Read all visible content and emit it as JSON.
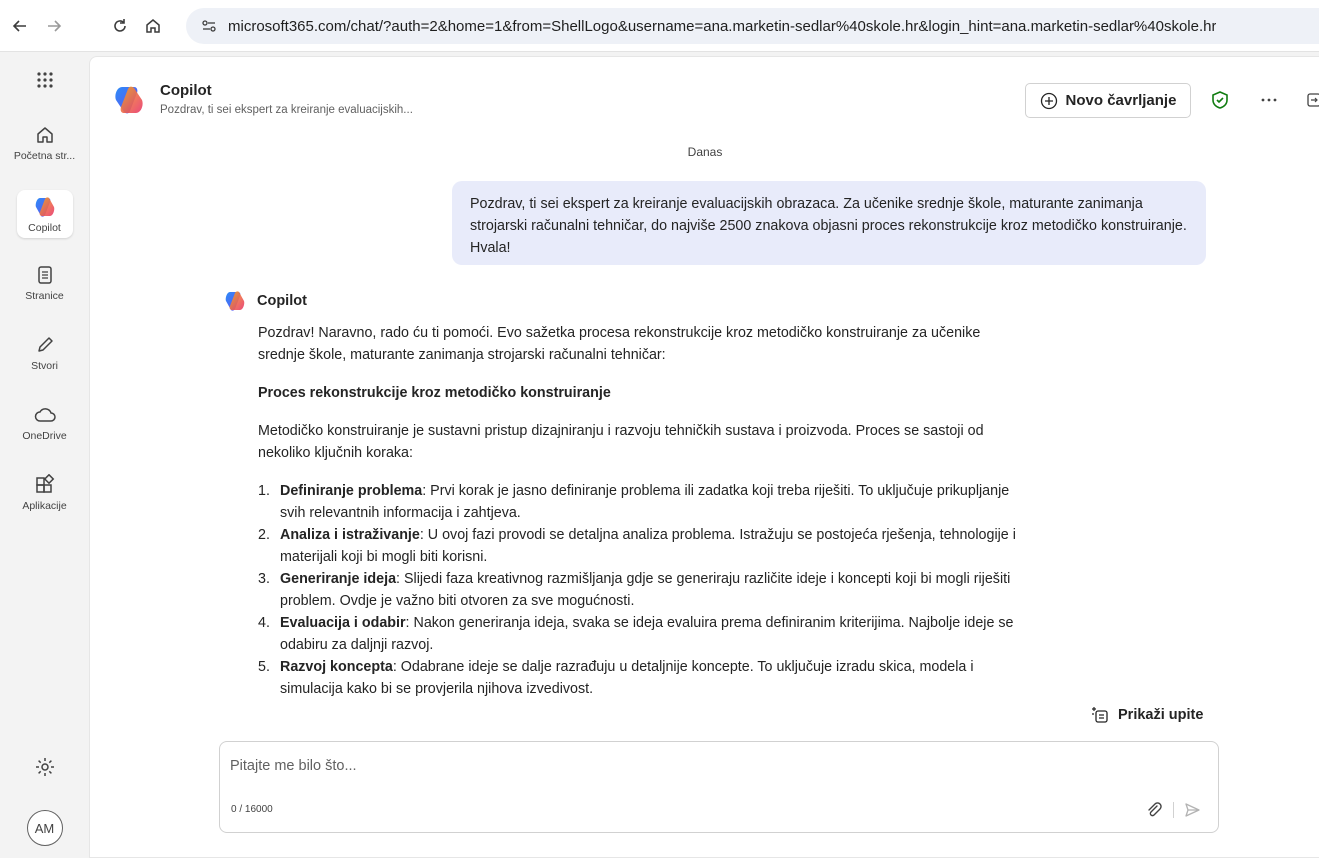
{
  "browser": {
    "url": "microsoft365.com/chat/?auth=2&home=1&from=ShellLogo&username=ana.marketin-sedlar%40skole.hr&login_hint=ana.marketin-sedlar%40skole.hr"
  },
  "rail": {
    "items": [
      {
        "label": "Početna str...",
        "icon": "home-icon"
      },
      {
        "label": "Copilot",
        "icon": "copilot-icon"
      },
      {
        "label": "Stranice",
        "icon": "pages-icon"
      },
      {
        "label": "Stvori",
        "icon": "pen-icon"
      },
      {
        "label": "OneDrive",
        "icon": "cloud-icon"
      },
      {
        "label": "Aplikacije",
        "icon": "apps-icon"
      }
    ],
    "avatar_initials": "AM"
  },
  "header": {
    "title": "Copilot",
    "subtitle": "Pozdrav, ti sei ekspert za kreiranje evaluacijskih...",
    "new_chat_label": "Novo čavrljanje"
  },
  "chat": {
    "date_separator": "Danas",
    "user_message": "Pozdrav, ti sei ekspert za kreiranje evaluacijskih obrazaca. Za učenike srednje škole, maturante zanimanja strojarski računalni tehničar, do najviše 2500 znakova objasni proces rekonstrukcije kroz metodičko konstruiranje. Hvala!",
    "ai_name": "Copilot",
    "ai_intro": "Pozdrav! Naravno, rado ću ti pomoći. Evo sažetka procesa rekonstrukcije kroz metodičko konstruiranje za učenike srednje škole, maturante zanimanja strojarski računalni tehničar:",
    "ai_heading": "Proces rekonstrukcije kroz metodičko konstruiranje",
    "ai_paragraph": "Metodičko konstruiranje je sustavni pristup dizajniranju i razvoju tehničkih sustava i proizvoda. Proces se sastoji od nekoliko ključnih koraka:",
    "steps": [
      {
        "num": "1.",
        "title": "Definiranje problema",
        "text": ": Prvi korak je jasno definiranje problema ili zadatka koji treba riješiti. To uključuje prikupljanje svih relevantnih informacija i zahtjeva."
      },
      {
        "num": "2.",
        "title": "Analiza i istraživanje",
        "text": ": U ovoj fazi provodi se detaljna analiza problema. Istražuju se postojeća rješenja, tehnologije i materijali koji bi mogli biti korisni."
      },
      {
        "num": "3.",
        "title": "Generiranje ideja",
        "text": ": Slijedi faza kreativnog razmišljanja gdje se generiraju različite ideje i koncepti koji bi mogli riješiti problem. Ovdje je važno biti otvoren za sve mogućnosti."
      },
      {
        "num": "4.",
        "title": "Evaluacija i odabir",
        "text": ": Nakon generiranja ideja, svaka se ideja evaluira prema definiranim kriterijima. Najbolje ideje se odabiru za daljnji razvoj."
      },
      {
        "num": "5.",
        "title": "Razvoj koncepta",
        "text": ": Odabrane ideje se dalje razrađuju u detaljnije koncepte. To uključuje izradu skica, modela i simulacija kako bi se provjerila njihova izvedivost."
      }
    ],
    "show_prompts_label": "Prikaži upite"
  },
  "composer": {
    "placeholder": "Pitajte me bilo što...",
    "counter": "0 / 16000"
  },
  "colors": {
    "accent": "#3b5bdb",
    "user_bubble": "#e8ebfa",
    "shield": "#107c10"
  }
}
